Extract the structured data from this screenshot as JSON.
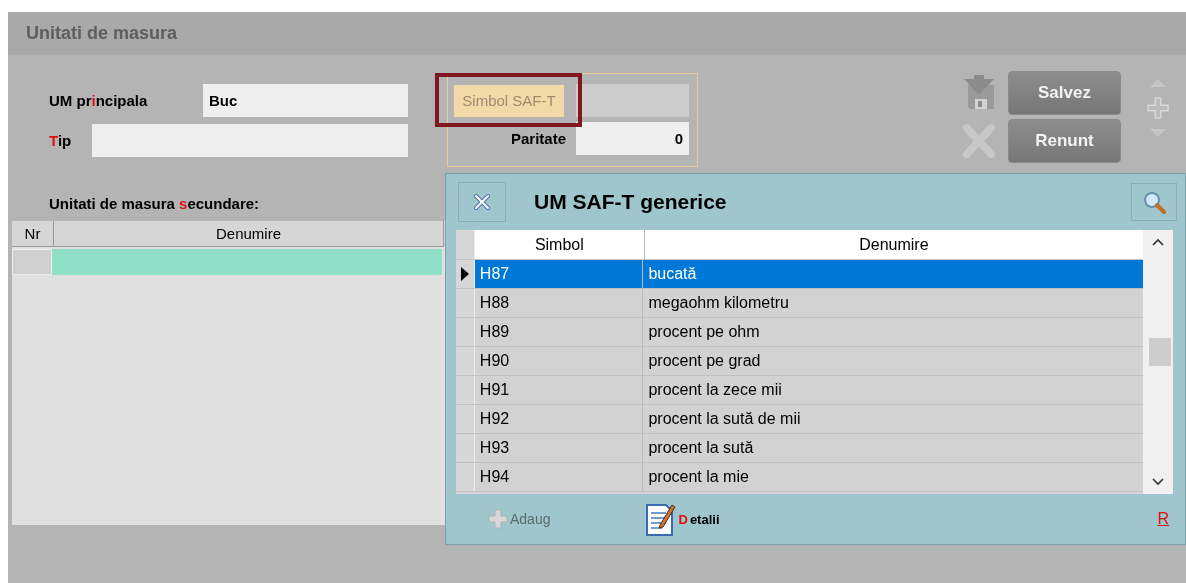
{
  "window": {
    "title": "Unitati de masura"
  },
  "form": {
    "um_principala": {
      "label": {
        "before": "UM pr",
        "key": "i",
        "after": "ncipala"
      },
      "value": "Buc"
    },
    "tip": {
      "label": {
        "key": "T",
        "after": "ip"
      }
    }
  },
  "saft": {
    "button": "Simbol SAF-T",
    "focused": true,
    "paritate_label": "Paritate",
    "paritate_value": "0"
  },
  "buttons": [
    {
      "label": "Salvez",
      "kind": "save",
      "disabled": true
    },
    {
      "label": "Renunt",
      "kind": "cancel",
      "disabled": true
    }
  ],
  "secondary": {
    "label": {
      "before": "Unitati de masura ",
      "key": "s",
      "after": "ecundare:"
    },
    "columns": [
      "Nr",
      "Denumire"
    ]
  },
  "popup": {
    "title": "UM SAF-T generice",
    "columns": [
      "Simbol",
      "Denumire"
    ],
    "rows": [
      {
        "simbol": "H87",
        "denumire": "bucată",
        "selected": true
      },
      {
        "simbol": "H88",
        "denumire": "megaohm kilometru",
        "selected": false
      },
      {
        "simbol": "H89",
        "denumire": "procent pe ohm",
        "selected": false
      },
      {
        "simbol": "H90",
        "denumire": "procent pe grad",
        "selected": false
      },
      {
        "simbol": "H91",
        "denumire": "procent la zece mii",
        "selected": false
      },
      {
        "simbol": "H92",
        "denumire": "procent la sută de mii",
        "selected": false
      },
      {
        "simbol": "H93",
        "denumire": "procent la sută",
        "selected": false
      },
      {
        "simbol": "H94",
        "denumire": "procent la mie",
        "selected": false
      }
    ],
    "footer": {
      "add": {
        "label": "Adaug",
        "disabled": true
      },
      "details": {
        "label": {
          "key": "D",
          "after": "etalii"
        }
      },
      "link": "R"
    }
  }
}
